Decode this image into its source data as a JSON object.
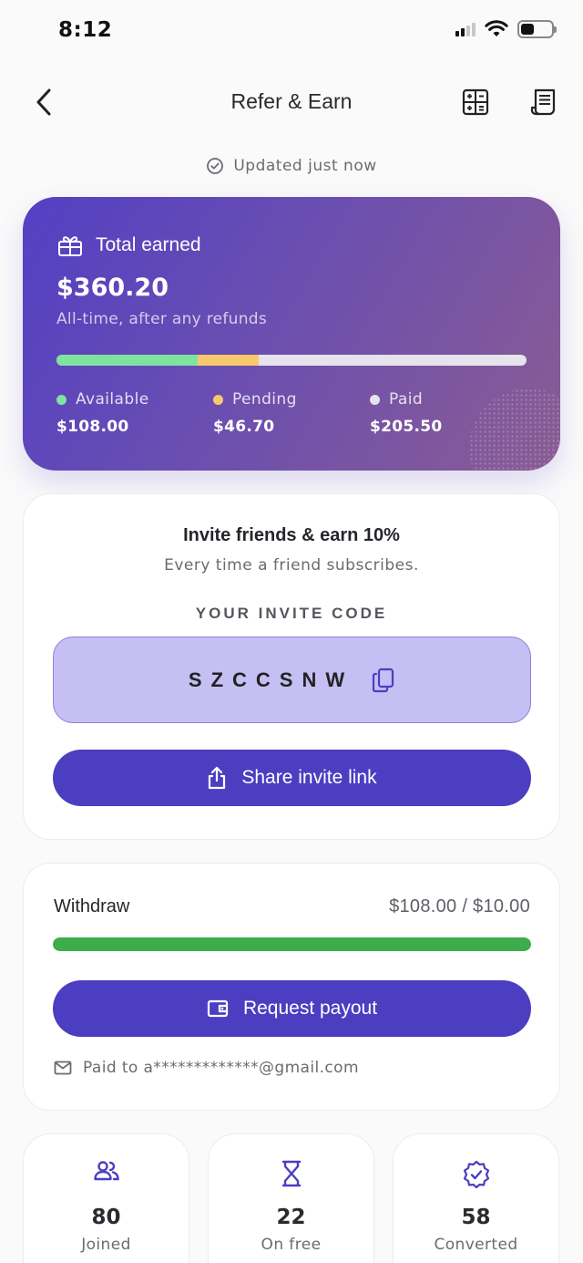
{
  "status_bar": {
    "time": "8:12"
  },
  "header": {
    "title": "Refer & Earn"
  },
  "updated_text": "Updated just now",
  "earned": {
    "label": "Total earned",
    "amount": "$360.20",
    "subtitle": "All-time, after any refunds",
    "breakdown_share": {
      "available": 0.3,
      "pending": 0.13,
      "paid": 0.57
    },
    "legend": [
      {
        "label": "Available",
        "value": "$108.00",
        "color": "#7fe3a0"
      },
      {
        "label": "Pending",
        "value": "$46.70",
        "color": "#f8c86b"
      },
      {
        "label": "Paid",
        "value": "$205.50",
        "color": "#e6e3ec"
      }
    ]
  },
  "invite": {
    "title": "Invite friends & earn 10%",
    "subtitle": "Every time a friend subscribes.",
    "code_label": "YOUR INVITE CODE",
    "code": "SZCCSNW",
    "share_label": "Share invite link"
  },
  "withdraw": {
    "label": "Withdraw",
    "amount": "$108.00 / $10.00",
    "progress": 1.0,
    "button_label": "Request payout",
    "paid_to": "Paid to a*************@gmail.com"
  },
  "stats": [
    {
      "value": "80",
      "label": "Joined",
      "icon": "users-icon"
    },
    {
      "value": "22",
      "label": "On free",
      "icon": "hourglass-icon"
    },
    {
      "value": "58",
      "label": "Converted",
      "icon": "verified-badge-icon"
    }
  ],
  "colors": {
    "accent": "#4b3ec1",
    "progress_green": "#3fac4c",
    "code_bg": "#c5bff3"
  }
}
